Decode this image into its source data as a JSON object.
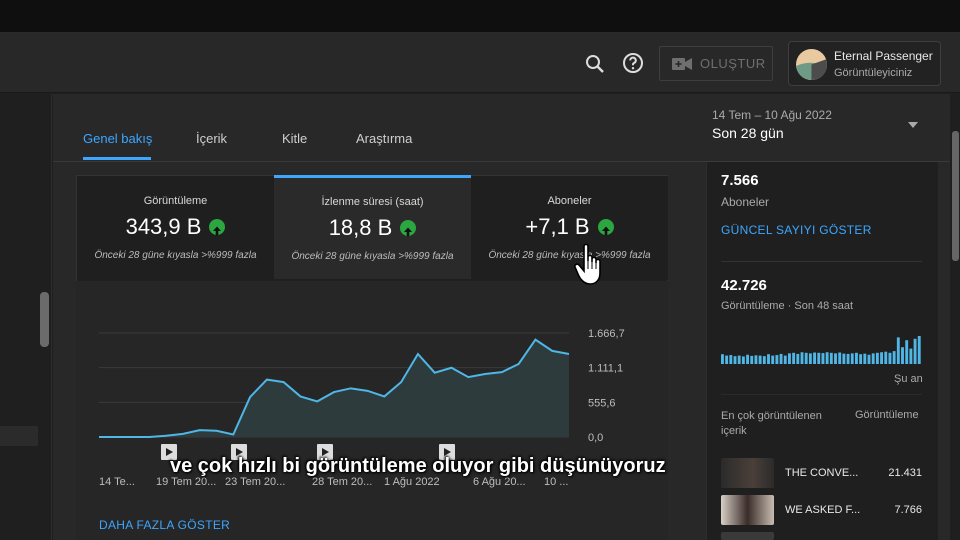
{
  "header": {
    "create_label": "OLUŞTUR",
    "channel_name": "Eternal Passenger",
    "channel_role": "Görüntüleyiciniz",
    "icons": [
      "search-icon",
      "help-icon",
      "video-camera-icon"
    ]
  },
  "tabs": [
    {
      "label": "Genel bakış",
      "active": true
    },
    {
      "label": "İçerik",
      "active": false
    },
    {
      "label": "Kitle",
      "active": false
    },
    {
      "label": "Araştırma",
      "active": false
    }
  ],
  "date": {
    "range": "14 Tem – 10 Ağu 2022",
    "label": "Son 28 gün"
  },
  "metrics": [
    {
      "title": "Görüntüleme",
      "value": "343,9 B",
      "compare": "Önceki 28 güne kıyasla >%999 fazla",
      "active": false
    },
    {
      "title": "İzlenme süresi (saat)",
      "value": "18,8 B",
      "compare": "Önceki 28 güne kıyasla >%999 fazla",
      "active": true
    },
    {
      "title": "Aboneler",
      "value": "+7,1 B",
      "compare": "Önceki 28 güne kıyasla >%999 fazla",
      "active": false
    }
  ],
  "more_link": "DAHA FAZLA GÖSTER",
  "chart_data": {
    "type": "area",
    "ytick_labels": [
      "1.666,7",
      "1.111,1",
      "555,6",
      "0,0"
    ],
    "ylim": [
      0,
      1666.7
    ],
    "xtick_labels": [
      "14 Te...",
      "19 Tem 20...",
      "23 Tem 20...",
      "28 Tem 20...",
      "1 Ağu 2022",
      "6 Ağu 20...",
      "10 ..."
    ],
    "values": [
      0,
      0,
      0,
      0,
      20,
      50,
      110,
      100,
      40,
      640,
      920,
      880,
      650,
      570,
      720,
      780,
      740,
      650,
      880,
      1330,
      1030,
      1110,
      960,
      1010,
      1040,
      1170,
      1560,
      1380,
      1330
    ],
    "grid": true,
    "colors": {
      "line": "#4fb6e6",
      "fill": "#2d3b3d"
    }
  },
  "side": {
    "subs_value": "7.566",
    "subs_label": "Aboneler",
    "subs_link": "GÜNCEL SAYIYI GÖSTER",
    "views_value": "42.726",
    "views_label": "Görüntüleme · Son 48 saat",
    "now_label": "Şu an",
    "top_header": "En çok görüntülenen içerik",
    "top_header_right": "Görüntüleme",
    "top_items": [
      {
        "title": "THE CONVE...",
        "views": "21.431"
      },
      {
        "title": "WE ASKED F...",
        "views": "7.766"
      }
    ],
    "mini_bars": [
      0.35,
      0.3,
      0.32,
      0.28,
      0.3,
      0.27,
      0.33,
      0.29,
      0.31,
      0.3,
      0.28,
      0.35,
      0.3,
      0.32,
      0.36,
      0.3,
      0.38,
      0.4,
      0.36,
      0.42,
      0.4,
      0.38,
      0.41,
      0.4,
      0.39,
      0.42,
      0.4,
      0.38,
      0.41,
      0.37,
      0.36,
      0.38,
      0.4,
      0.35,
      0.37,
      0.33,
      0.38,
      0.4,
      0.42,
      0.44,
      0.4,
      0.46,
      0.95,
      0.6,
      0.85,
      0.55,
      0.9,
      1.0
    ]
  },
  "caption": "ve çok hızlı bi görüntüleme oluyor gibi düşünüyoruz"
}
